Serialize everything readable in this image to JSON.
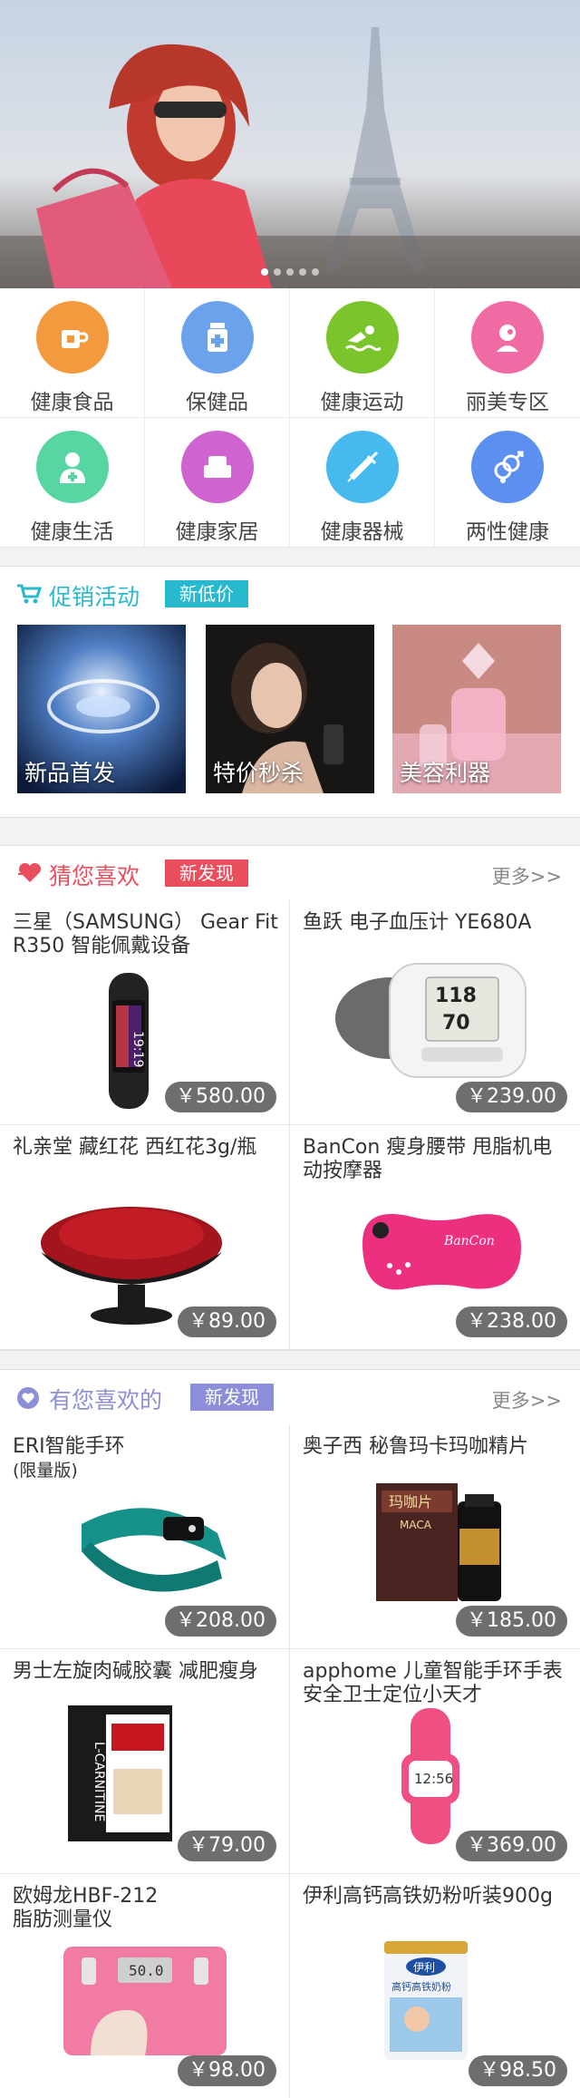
{
  "banner": {
    "dots": 5,
    "active_dot": 1
  },
  "categories": [
    {
      "label": "健康食品",
      "icon": "food-icon",
      "color": "#f39a3f"
    },
    {
      "label": "保健品",
      "icon": "supplement-bottle-icon",
      "color": "#6aa3ec"
    },
    {
      "label": "健康运动",
      "icon": "swimming-icon",
      "color": "#7bc42c"
    },
    {
      "label": "丽美专区",
      "icon": "beauty-face-icon",
      "color": "#f06ba3"
    },
    {
      "label": "健康生活",
      "icon": "doctor-icon",
      "color": "#57d6a3"
    },
    {
      "label": "健康家居",
      "icon": "armchair-icon",
      "color": "#cf63cf"
    },
    {
      "label": "健康器械",
      "icon": "syringe-icon",
      "color": "#46b9ee"
    },
    {
      "label": "两性健康",
      "icon": "gender-icon",
      "color": "#5b8ff0"
    }
  ],
  "promo": {
    "title": "促销活动",
    "tag": "新低价",
    "items": [
      {
        "label": "新品首发"
      },
      {
        "label": "特价秒杀"
      },
      {
        "label": "美容利器"
      }
    ]
  },
  "guess": {
    "title": "猜您喜欢",
    "tag": "新发现",
    "more": "更多>>",
    "products": [
      {
        "title": "三星（SAMSUNG） Gear Fit R350 智能佩戴设备",
        "price": "￥580.00"
      },
      {
        "title": "鱼跃 电子血压计 YE680A",
        "price": "￥239.00"
      },
      {
        "title": "礼亲堂 藏红花 西红花3g/瓶",
        "price": "￥89.00"
      },
      {
        "title": "BanCon 瘦身腰带 甩脂机电动按摩器",
        "price": "￥238.00"
      }
    ]
  },
  "like": {
    "title": "有您喜欢的",
    "tag": "新发现",
    "more": "更多>>",
    "products": [
      {
        "title": "ERI智能手环",
        "subtitle": "(限量版)",
        "price": "￥208.00"
      },
      {
        "title": "奥子西 秘鲁玛卡玛咖精片",
        "price": "￥185.00"
      },
      {
        "title": "男士左旋肉碱胶囊 减肥瘦身",
        "price": "￥79.00"
      },
      {
        "title": "apphome 儿童智能手环手表 安全卫士定位小天才",
        "price": "￥369.00"
      },
      {
        "title": "欧姆龙HBF-212",
        "subtitle": "脂肪测量仪",
        "price": "￥98.00"
      },
      {
        "title": "伊利高钙高铁奶粉听装900g",
        "price": "￥98.50"
      }
    ]
  },
  "colors": {
    "promo_accent": "#29b9cf",
    "guess_accent": "#ea4e5d",
    "like_accent": "#8c8fd8",
    "price_bg": "#6e6e6e"
  },
  "product_text": {
    "watch_screen": "19:19",
    "bp_reading_top": "118",
    "bp_reading_mid": "70",
    "massager_brand": "BanCon",
    "maca_box": "玛咖片",
    "maca_sub": "MACA",
    "carnitine_box": "L-CARNITINE",
    "kid_watch": "12:56",
    "scale_display": "50.0",
    "milk_brand": "伊利",
    "milk_sub": "高钙高铁奶粉"
  }
}
